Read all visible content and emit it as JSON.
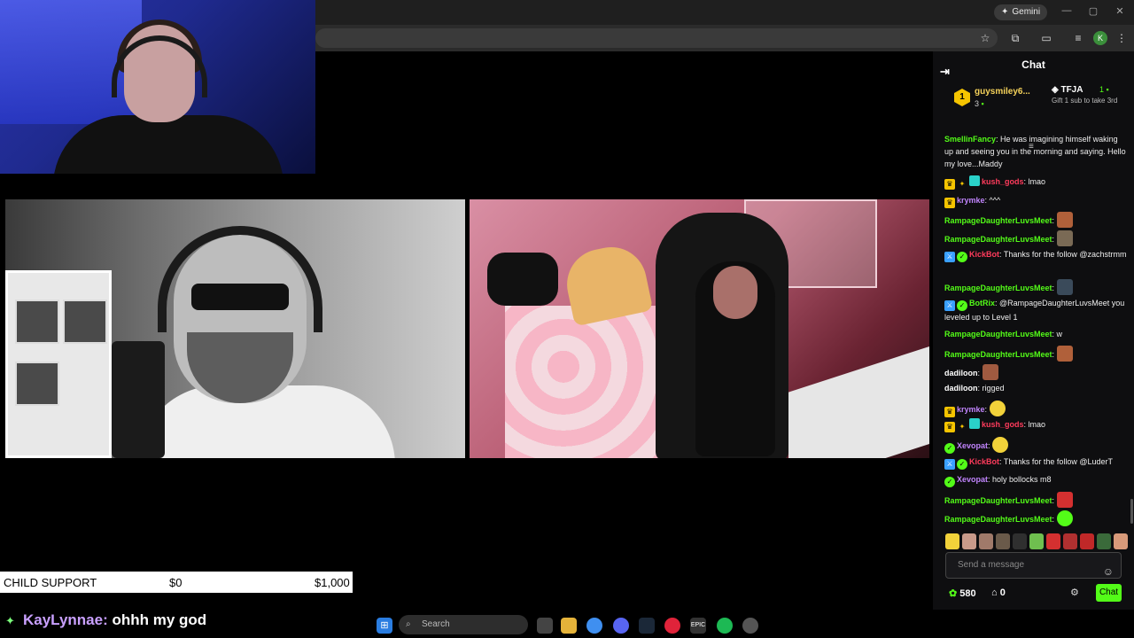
{
  "browser": {
    "gemini_label": "Gemini",
    "profile_initial": "K"
  },
  "stream_overlay": {
    "goal_label": "CHILD SUPPORT",
    "goal_current": "$0",
    "goal_target": "$1,000",
    "chat_user": "KayLynnae:",
    "chat_text": " ohhh my god"
  },
  "taskbar": {
    "search_placeholder": "Search"
  },
  "chat": {
    "title": "Chat",
    "leaderboard": [
      {
        "rank": "1",
        "name": "guysmiley6...",
        "count": "3"
      },
      {
        "name": "TFJA",
        "count": "1",
        "note": "Gift 1 sub to take 3rd"
      }
    ],
    "messages": [
      {
        "user": "SmellinFancy",
        "color": "green",
        "text": "He was imagining himself waking up and seeing you in the morning and saying. Hello my love...Maddy"
      },
      {
        "user": "kush_gods",
        "color": "red",
        "text": "lmao"
      },
      {
        "user": "krymke",
        "color": "purple",
        "text": "^^^"
      },
      {
        "user": "RampageDaughterLuvsMeet",
        "color": "green",
        "text": ""
      },
      {
        "user": "RampageDaughterLuvsMeet",
        "color": "green",
        "text": ""
      },
      {
        "user": "KickBot",
        "color": "red",
        "text": "Thanks for the follow @zachstrmm"
      },
      {
        "user": "RampageDaughterLuvsMeet",
        "color": "green",
        "text": ""
      },
      {
        "user": "BotRix",
        "color": "green",
        "text": "@RampageDaughterLuvsMeet you leveled up to Level 1"
      },
      {
        "user": "RampageDaughterLuvsMeet",
        "color": "green",
        "text": "w"
      },
      {
        "user": "RampageDaughterLuvsMeet",
        "color": "green",
        "text": ""
      },
      {
        "user": "dadiloon",
        "color": "white",
        "text": ""
      },
      {
        "user": "dadiloon",
        "color": "white",
        "text": "rigged"
      },
      {
        "user": "krymke",
        "color": "purple",
        "text": ""
      },
      {
        "user": "kush_gods",
        "color": "red",
        "text": "lmao"
      },
      {
        "user": "Xevopat",
        "color": "purple",
        "text": ""
      },
      {
        "user": "KickBot",
        "color": "red",
        "text": "Thanks for the follow @LuderT"
      },
      {
        "user": "Xevopat",
        "color": "purple",
        "text": "holy bollocks m8"
      },
      {
        "user": "RampageDaughterLuvsMeet",
        "color": "green",
        "text": ""
      },
      {
        "user": "RampageDaughterLuvsMeet",
        "color": "green",
        "text": ""
      }
    ],
    "input_placeholder": "Send a message",
    "points": "580",
    "store_count": "0",
    "send_label": "Chat"
  },
  "colors": {
    "kick_green": "#53fc18",
    "chat_bg": "#0e0e10"
  }
}
